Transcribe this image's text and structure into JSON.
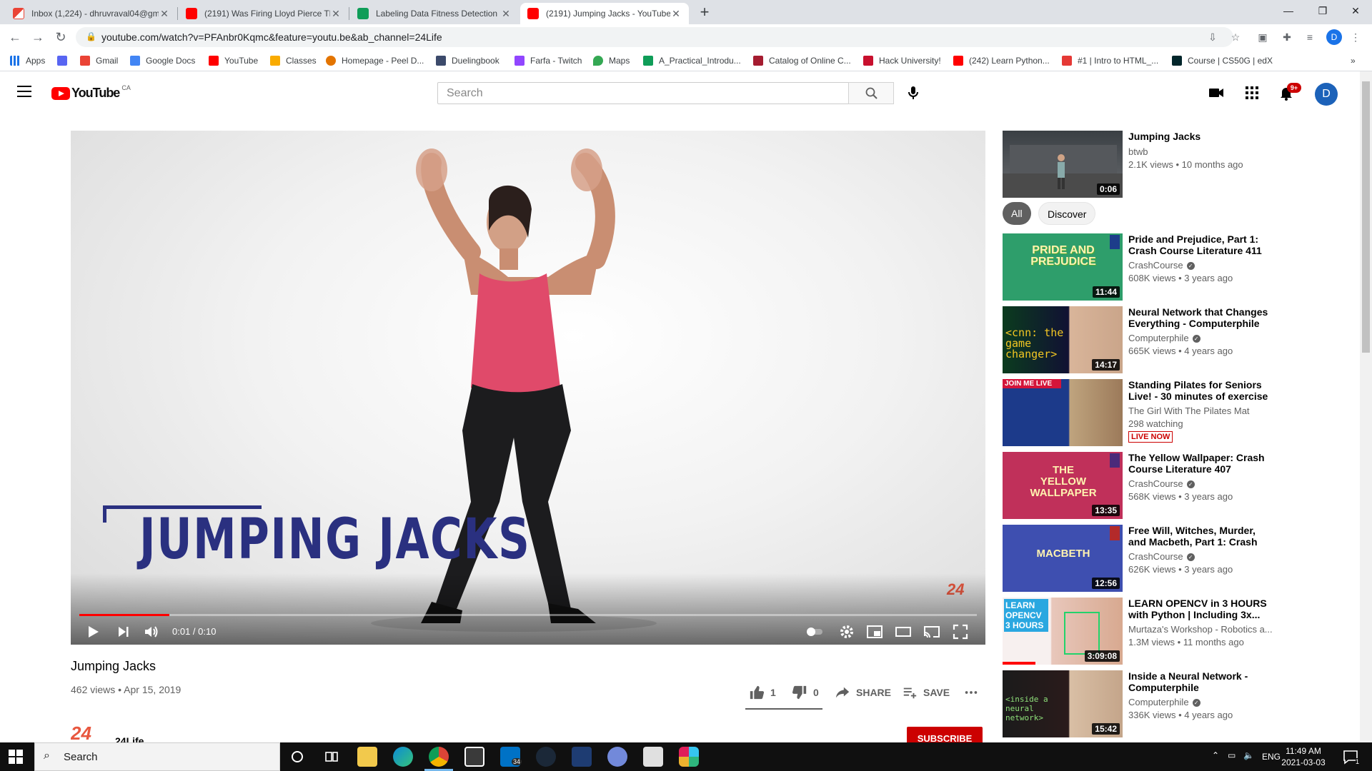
{
  "browser": {
    "tabs": [
      {
        "title": "Inbox (1,224) - dhruvraval04@gm",
        "active": false,
        "favicon": "gmail-icon"
      },
      {
        "title": "(2191) Was Firing Lloyd Pierce Th",
        "active": false,
        "favicon": "youtube-icon"
      },
      {
        "title": "Labeling Data Fitness Detection",
        "active": false,
        "favicon": "sheets-icon"
      },
      {
        "title": "(2191) Jumping Jacks - YouTube",
        "active": true,
        "favicon": "youtube-icon"
      }
    ],
    "url": "youtube.com/watch?v=PFAnbr0Kqmc&feature=youtu.be&ab_channel=24Life",
    "profile_initial": "D",
    "bookmarks": [
      {
        "label": "Apps"
      },
      {
        "label": ""
      },
      {
        "label": "Gmail"
      },
      {
        "label": "Google Docs"
      },
      {
        "label": "YouTube"
      },
      {
        "label": "Classes"
      },
      {
        "label": "Homepage - Peel D..."
      },
      {
        "label": "Duelingbook"
      },
      {
        "label": "Farfa - Twitch"
      },
      {
        "label": "Maps"
      },
      {
        "label": "A_Practical_Introdu..."
      },
      {
        "label": "Catalog of Online C..."
      },
      {
        "label": "Hack University!"
      },
      {
        "label": "(242) Learn Python..."
      },
      {
        "label": "#1 | Intro to HTML_..."
      },
      {
        "label": "Course | CS50G | edX"
      }
    ]
  },
  "youtube": {
    "logo_text": "YouTube",
    "country": "CA",
    "search_placeholder": "Search",
    "notif_count": "9+",
    "avatar_initial": "D"
  },
  "player": {
    "overlay_title": "JUMPING JACKS",
    "watermark": "24",
    "time": "0:01 / 0:10",
    "progress": 0.1
  },
  "video": {
    "title": "Jumping Jacks",
    "meta": "462 views • Apr 15, 2019",
    "likes": "1",
    "dislikes": "0",
    "share_label": "SHARE",
    "save_label": "SAVE",
    "like_ratio": 1.0,
    "channel_logo": "24",
    "channel": "24Life",
    "subscribe_label": "SUBSCRIBE"
  },
  "sidebar": {
    "top": {
      "title": "Jumping Jacks",
      "channel": "btwb",
      "meta": "2.1K views • 10 months ago",
      "duration": "0:06"
    },
    "chips": [
      "All",
      "Discover"
    ],
    "recs": [
      {
        "title": "Pride and Prejudice, Part 1: Crash Course Literature 411",
        "channel": "CrashCourse",
        "verified": true,
        "meta": "608K views • 3 years ago",
        "duration": "11:44",
        "thumb_text": "PRIDE AND PREJUDICE"
      },
      {
        "title": "Neural Network that Changes Everything - Computerphile",
        "channel": "Computerphile",
        "verified": true,
        "meta": "665K views • 4 years ago",
        "duration": "14:17",
        "thumb_text": "<cnn: the game changer>"
      },
      {
        "title": "Standing Pilates for Seniors Live! - 30 minutes of exercise t...",
        "channel": "The Girl With The Pilates Mat",
        "verified": false,
        "meta": "298 watching",
        "live": "LIVE NOW",
        "duration": "",
        "thumb_text": "JOIN ME LIVE"
      },
      {
        "title": "The Yellow Wallpaper: Crash Course Literature 407",
        "channel": "CrashCourse",
        "verified": true,
        "meta": "568K views • 3 years ago",
        "duration": "13:35",
        "thumb_text": "THE YELLOW WALLPAPER"
      },
      {
        "title": "Free Will, Witches, Murder, and Macbeth, Part 1: Crash Course...",
        "channel": "CrashCourse",
        "verified": true,
        "meta": "626K views • 3 years ago",
        "duration": "12:56",
        "thumb_text": "MACBETH"
      },
      {
        "title": "LEARN OPENCV in 3 HOURS with Python | Including 3x...",
        "channel": "Murtaza's Workshop - Robotics a...",
        "verified": false,
        "meta": "1.3M views • 11 months ago",
        "duration": "3:09:08",
        "thumb_text": "LEARN OPENCV 3 HOURS"
      },
      {
        "title": "Inside a Neural Network - Computerphile",
        "channel": "Computerphile",
        "verified": true,
        "meta": "336K views • 4 years ago",
        "duration": "15:42",
        "thumb_text": "<inside a neural network>"
      }
    ]
  },
  "taskbar": {
    "search_placeholder": "Search",
    "mail_badge": "34",
    "lang": "ENG",
    "time": "11:49 AM",
    "date": "2021-03-03",
    "notif_count": "1"
  },
  "colors": {
    "yt_red": "#ff0000",
    "subscribe_red": "#cc0000",
    "overlay_navy": "#2a3080",
    "brand_24": "#e8573f"
  }
}
